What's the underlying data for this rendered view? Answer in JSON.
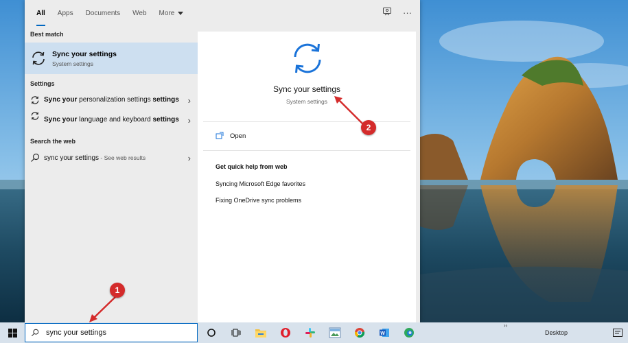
{
  "topnav": {
    "tabs": [
      {
        "label": "All",
        "active": true
      },
      {
        "label": "Apps",
        "active": false
      },
      {
        "label": "Documents",
        "active": false
      },
      {
        "label": "Web",
        "active": false
      },
      {
        "label": "More",
        "active": false
      }
    ],
    "icons": [
      "feedback-icon",
      "more-options-icon"
    ]
  },
  "results": {
    "best_match_heading": "Best match",
    "best_match": {
      "title": "Sync your settings",
      "subtitle": "System settings",
      "icon": "sync-icon"
    },
    "settings_heading": "Settings",
    "settings_items": [
      {
        "bold_prefix": "Sync your",
        "rest": " personalization settings"
      },
      {
        "bold_prefix": "Sync your",
        "rest": " language and keyboard ",
        "bold_suffix": "settings"
      }
    ],
    "web_heading": "Search the web",
    "web_item": {
      "query": "sync your settings",
      "extra": " - See web results"
    }
  },
  "preview": {
    "title": "Sync your settings",
    "subtitle": "System settings",
    "open_label": "Open",
    "help_heading": "Get quick help from web",
    "help_links": [
      "Syncing Microsoft Edge favorites",
      "Fixing OneDrive sync problems"
    ],
    "accent": "#1a73d9"
  },
  "taskbar": {
    "search_value": "sync your settings",
    "desktop_label": "Desktop",
    "apps": [
      "cortana-icon",
      "task-view-icon",
      "file-explorer-icon",
      "opera-icon",
      "slack-icon",
      "photos-icon",
      "chrome-icon",
      "word-icon",
      "edge-icon"
    ]
  },
  "annotations": {
    "badge1": "1",
    "badge2": "2",
    "color": "#d42b2b"
  }
}
